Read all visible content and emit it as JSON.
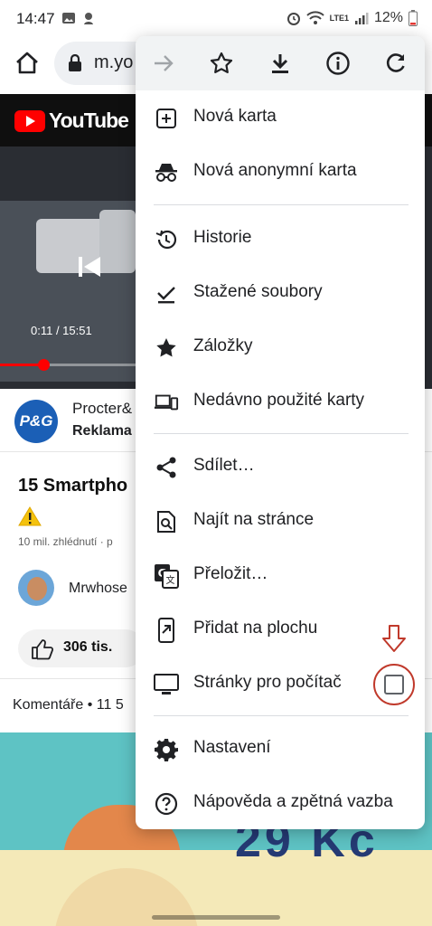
{
  "status": {
    "time": "14:47",
    "battery": "12%",
    "network": "LTE1"
  },
  "address_bar": {
    "url": "m.yo"
  },
  "youtube": {
    "logo_text": "YouTube",
    "video_time": "0:11 / 15:51",
    "progress": 0.012,
    "channel_name": "Procter&",
    "channel_badge": "Reklama",
    "channel_logo": "P&G",
    "title": "15 Smartpho",
    "views": "10 mil. zhlédnutí · p",
    "author": "Mrwhose",
    "likes": "306 tis.",
    "comments": "Komentáře • 11 5",
    "ad_price": "29 Kč"
  },
  "menu": {
    "top_icons": [
      "forward-icon",
      "star-icon",
      "download-icon",
      "info-icon",
      "reload-icon"
    ],
    "items": [
      {
        "label": "Nová karta",
        "icon": "new-tab-icon"
      },
      {
        "label": "Nová anonymní karta",
        "icon": "incognito-icon"
      },
      {
        "label": "Historie",
        "icon": "history-icon"
      },
      {
        "label": "Stažené soubory",
        "icon": "downloads-icon"
      },
      {
        "label": "Záložky",
        "icon": "bookmarks-icon"
      },
      {
        "label": "Nedávno použité karty",
        "icon": "recent-tabs-icon"
      },
      {
        "label": "Sdílet…",
        "icon": "share-icon"
      },
      {
        "label": "Najít na stránce",
        "icon": "find-icon"
      },
      {
        "label": "Přeložit…",
        "icon": "translate-icon"
      },
      {
        "label": "Přidat na plochu",
        "icon": "add-to-home-icon"
      },
      {
        "label": "Stránky pro počítač",
        "icon": "desktop-icon",
        "checked": false
      },
      {
        "label": "Nastavení",
        "icon": "settings-icon"
      },
      {
        "label": "Nápověda a zpětná vazba",
        "icon": "help-icon"
      }
    ]
  },
  "colors": {
    "annotation": "#c0392b",
    "youtube_red": "#ff0000",
    "menu_top_bg": "#f1f3f4"
  }
}
